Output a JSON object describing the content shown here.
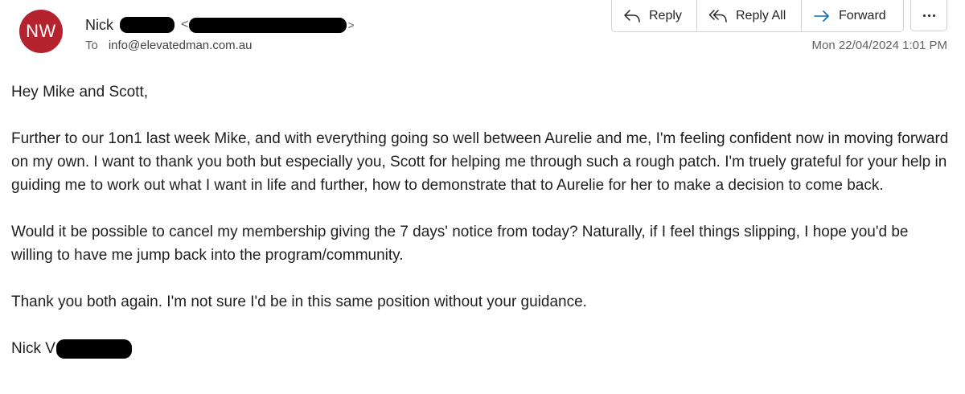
{
  "header": {
    "avatar_initials": "NW",
    "sender_first_name": "Nick",
    "sender_email_open": "<",
    "sender_email_close": ">",
    "to_label": "To",
    "to_address": "info@elevatedman.com.au",
    "date": "Mon 22/04/2024 1:01 PM"
  },
  "actions": {
    "reply_label": "Reply",
    "reply_all_label": "Reply All",
    "forward_label": "Forward",
    "more_icon": "more-horizontal-icon"
  },
  "colors": {
    "avatar_bg": "#b5232f",
    "accent_blue": "#0f6cbd"
  },
  "message": {
    "greeting": "Hey Mike and Scott,",
    "paragraph_1": "Further to our 1on1 last week Mike, and with everything going so well between Aurelie and me, I'm feeling confident now in moving forward on my own. I want to thank you both but especially you, Scott for helping me through such a rough patch. I'm truely grateful for your help in guiding me to work out what I want in life and further, how to demonstrate that to Aurelie for her to make a decision to come back.",
    "paragraph_2": "Would it be possible to cancel my membership giving the 7 days' notice from today? Naturally, if I feel things slipping, I hope you'd be willing to have me jump back into the program/community.",
    "paragraph_3": "Thank you both again. I'm not sure I'd be in this same position without your guidance.",
    "signature": "Nick V"
  }
}
